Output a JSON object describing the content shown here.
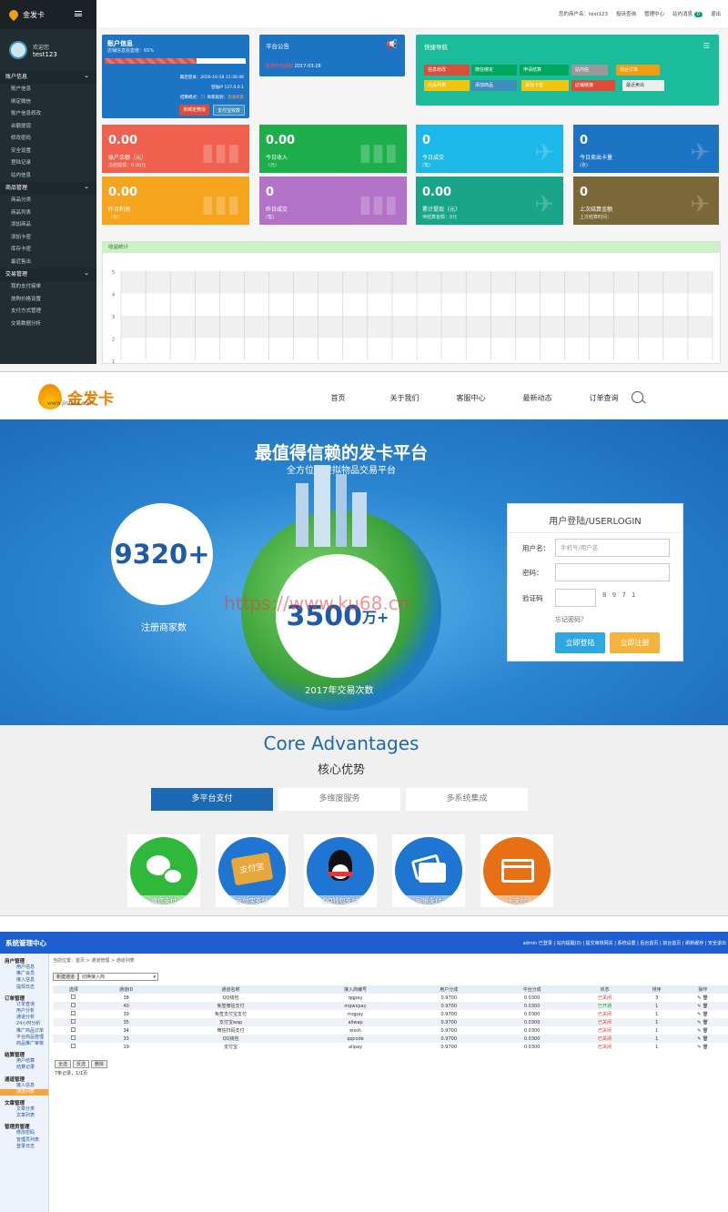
{
  "admin": {
    "brand": "金发卡",
    "user_welcome": "欢迎您",
    "user_name": "test123",
    "header_items": [
      "您的商户名：test123",
      "投诉查询",
      "管理中心",
      "站内消息",
      "退出"
    ],
    "msg_count": "0",
    "sidebar": [
      {
        "group": "账户信息",
        "items": [
          "账户信息",
          "绑定微信",
          "账户信息修改",
          "余额提现",
          "修改密码",
          "安全设置",
          "登陆记录",
          "站内信息"
        ]
      },
      {
        "group": "商品管理",
        "items": [
          "商品分类",
          "商品列表",
          "添加商品",
          "添加卡密",
          "库存卡密",
          "最近售出"
        ]
      },
      {
        "group": "交易管理",
        "items": [
          "我的支付接单",
          "放购价格设置",
          "支付方式管理",
          "交易数据分析"
        ]
      }
    ],
    "account_panel": {
      "title": "账户信息",
      "sub": "店铺信息完善度：65%",
      "progress": 0.65,
      "last_login": "最后登录：2016-10-18 11:30:46",
      "login_ip": "登陆IP 127.0.0.1",
      "settle": "结算模式：",
      "settle_val": "T1",
      "level": "商家级别：",
      "level_val": "普通商家",
      "btn1": "未绑定微信",
      "btn2": "支付宝收款"
    },
    "notice_panel": {
      "title": "平台公告",
      "item": "系统升级通知",
      "date": "2017-03-28"
    },
    "quick_panel": {
      "title": "快捷导航",
      "buttons": [
        "信息修改",
        "微信绑定",
        "申请结算",
        "站内信",
        "前台订单",
        "商品列表",
        "添加商品",
        "添加卡密",
        "店铺链接",
        "最近卖出"
      ]
    },
    "stats": [
      {
        "value": "0.00",
        "label": "账户余额（元）",
        "sub": "冻结提现：0.00元"
      },
      {
        "value": "0.00",
        "label": "今日收入",
        "sub": "（元）"
      },
      {
        "value": "0",
        "label": "今日成交",
        "sub": "(笔)"
      },
      {
        "value": "0",
        "label": "今日卖出卡量",
        "sub": "(张)"
      },
      {
        "value": "0.00",
        "label": "昨日利润",
        "sub": "（元）"
      },
      {
        "value": "0",
        "label": "昨日成交",
        "sub": "(笔)"
      },
      {
        "value": "0.00",
        "label": "累计提现（元）",
        "sub": "待结算金额：0元"
      },
      {
        "value": "0",
        "label": "上次结算金额",
        "sub": "上次结算时间："
      }
    ],
    "chart_title": "收益统计",
    "chart_yticks": [
      "5",
      "4",
      "3",
      "2",
      "1"
    ]
  },
  "site": {
    "brand": "金发卡",
    "url": "www.jinfaka.com",
    "nav": [
      "首页",
      "关于我们",
      "客服中心",
      "最新动态",
      "订单查询"
    ],
    "hero_title": "最值得信赖的发卡平台",
    "hero_sub": "全方位的虚拟物品交易平台",
    "merchants_num": "9320+",
    "merchants_label": "注册商家数",
    "trades_num": "3500",
    "trades_unit": "万+",
    "trades_label": "2017年交易次数",
    "watermark": "https://www.ku68.cn",
    "login": {
      "title": "用户登陆/USERLOGIN",
      "user_label": "用户名：",
      "user_ph": "手机号/用户名",
      "pwd_label": "密码：",
      "code_label": "验证码",
      "captcha": "8 9 7 1",
      "forgot": "忘记密码？",
      "login_btn": "立即登陆",
      "reg_btn": "立即注册"
    },
    "adv_en": "Core Advantages",
    "adv_cn": "核心优势",
    "tabs": [
      "多平台支付",
      "多维度服务",
      "多系统集成"
    ],
    "pays": [
      "微信支付",
      "支付宝支付",
      "QQ钱包支付",
      "网银支付",
      "卡支付"
    ],
    "alipay_text": "支付宝"
  },
  "system": {
    "title": "系统管理中心",
    "top_right": "admin 已登录 | 站内提醒(0) | 提交审核网关 | 系统设置 | 后台首页 | 前台首页 | 刷新缓存 | 安全退出",
    "breadcrumb": "当前位置：首页 > 通道管理 > 通道列表",
    "btn_new": "新建通道",
    "select_val": "切换接入商",
    "side": [
      {
        "g": "用户管理",
        "items": [
          "用户信息",
          "推广会员",
          "接入信息",
          "提现日志"
        ]
      },
      {
        "g": "订单管理",
        "items": [
          "订单查询",
          "用户分析",
          "通道分析",
          "24小时分析",
          "推广商品订单",
          "平台商品管理",
          "商品推广审核"
        ]
      },
      {
        "g": "结算管理",
        "items": [
          "用户结算",
          "结算记录"
        ]
      },
      {
        "g": "通道管理",
        "items": [
          "接入信息",
          "通道列表"
        ]
      },
      {
        "g": "文章管理",
        "items": [
          "文章分类",
          "文章列表"
        ]
      },
      {
        "g": "管理员管理",
        "items": [
          "修改密码",
          "管理员列表",
          "登录日志"
        ]
      }
    ],
    "columns": [
      "选择",
      "通道ID",
      "通道名称",
      "接入商编号",
      "用户分成",
      "平台分成",
      "状态",
      "排序",
      "操作"
    ],
    "rows": [
      [
        "38",
        "QQ钱包",
        "qqpay",
        "0.9700",
        "0.0300",
        "已关闭",
        "3"
      ],
      [
        "40",
        "免签微信支付",
        "mqwxpay",
        "0.9700",
        "0.0300",
        "已开通",
        "1"
      ],
      [
        "39",
        "免签支付宝支付",
        "mqpay",
        "0.9700",
        "0.0300",
        "已关闭",
        "1"
      ],
      [
        "35",
        "支付宝wap",
        "aliwap",
        "0.9700",
        "0.0300",
        "已关闭",
        "1"
      ],
      [
        "34",
        "微信扫码支付",
        "wxsh",
        "0.9700",
        "0.0300",
        "已关闭",
        "1"
      ],
      [
        "33",
        "QQ钱包",
        "qqcode",
        "0.9700",
        "0.0300",
        "已关闭",
        "1"
      ],
      [
        "19",
        "支付宝",
        "alipay",
        "0.9700",
        "0.0300",
        "已关闭",
        "1"
      ]
    ],
    "foot_btns": [
      "全选",
      "反选",
      "删除"
    ],
    "records": "7条记录，1/1页"
  }
}
